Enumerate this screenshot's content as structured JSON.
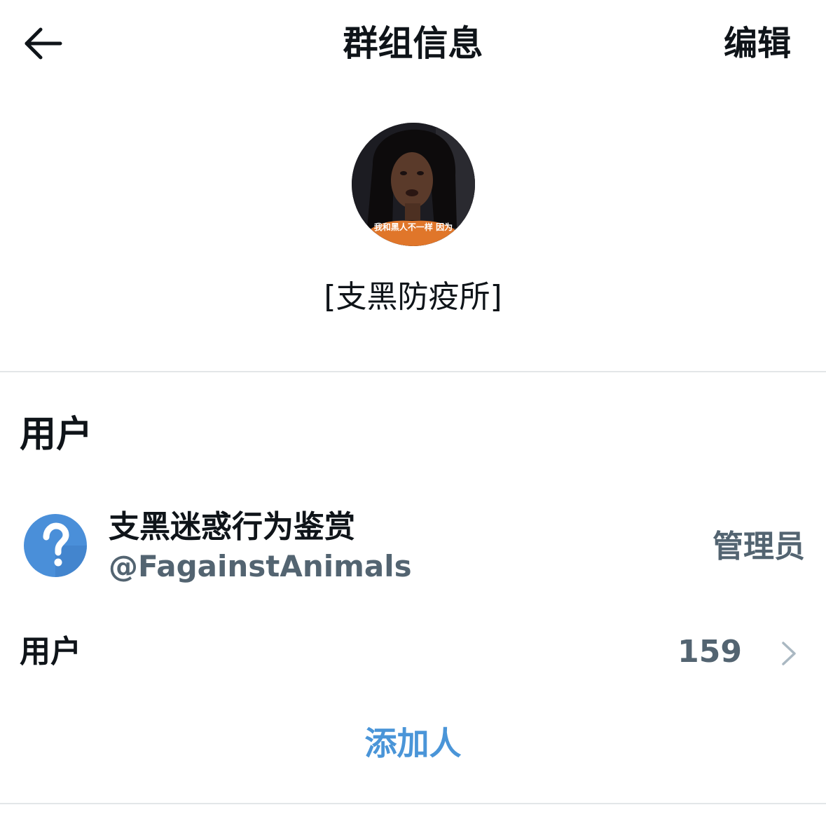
{
  "header": {
    "title": "群组信息",
    "edit_label": "编辑",
    "back_icon": "arrow-left-icon"
  },
  "group": {
    "avatar_caption": "我和黑人不一样 因为",
    "name": "[支黑防疫所]"
  },
  "members_section": {
    "heading": "用户",
    "members": [
      {
        "display_name": "支黑迷惑行为鉴赏",
        "handle": "@FagainstAnimals",
        "role": "管理员",
        "avatar_icon": "question-mark-icon"
      }
    ],
    "users_row": {
      "label": "用户",
      "count": "159",
      "chevron_icon": "chevron-right-icon"
    },
    "add_people_label": "添加人"
  },
  "colors": {
    "text_primary": "#0f1419",
    "text_secondary": "#536471",
    "accent_blue": "#4a95d8",
    "divider": "#e3e6e8",
    "avatar_blue": "#4a8fd9"
  }
}
